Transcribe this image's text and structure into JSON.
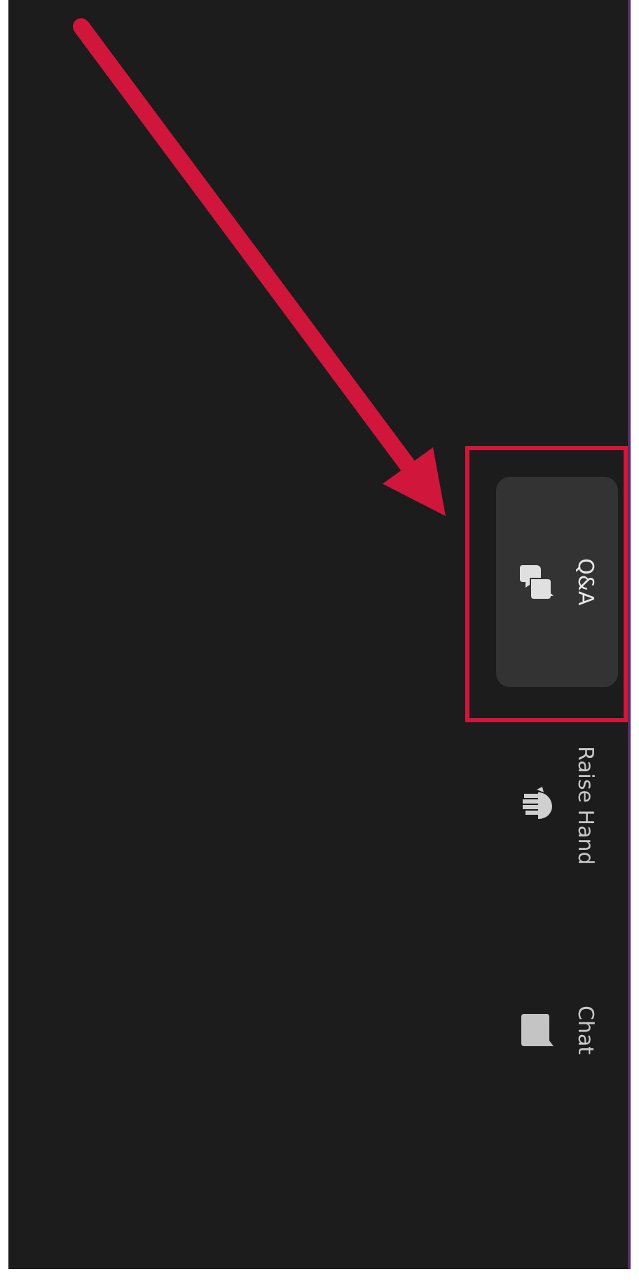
{
  "toolbar": {
    "items": [
      {
        "kind": "qa",
        "label": "Q&A",
        "selected": true,
        "highlighted": true
      },
      {
        "kind": "hand",
        "label": "Raise Hand",
        "selected": false,
        "highlighted": false
      },
      {
        "kind": "chat",
        "label": "Chat",
        "selected": false,
        "highlighted": false
      }
    ]
  }
}
